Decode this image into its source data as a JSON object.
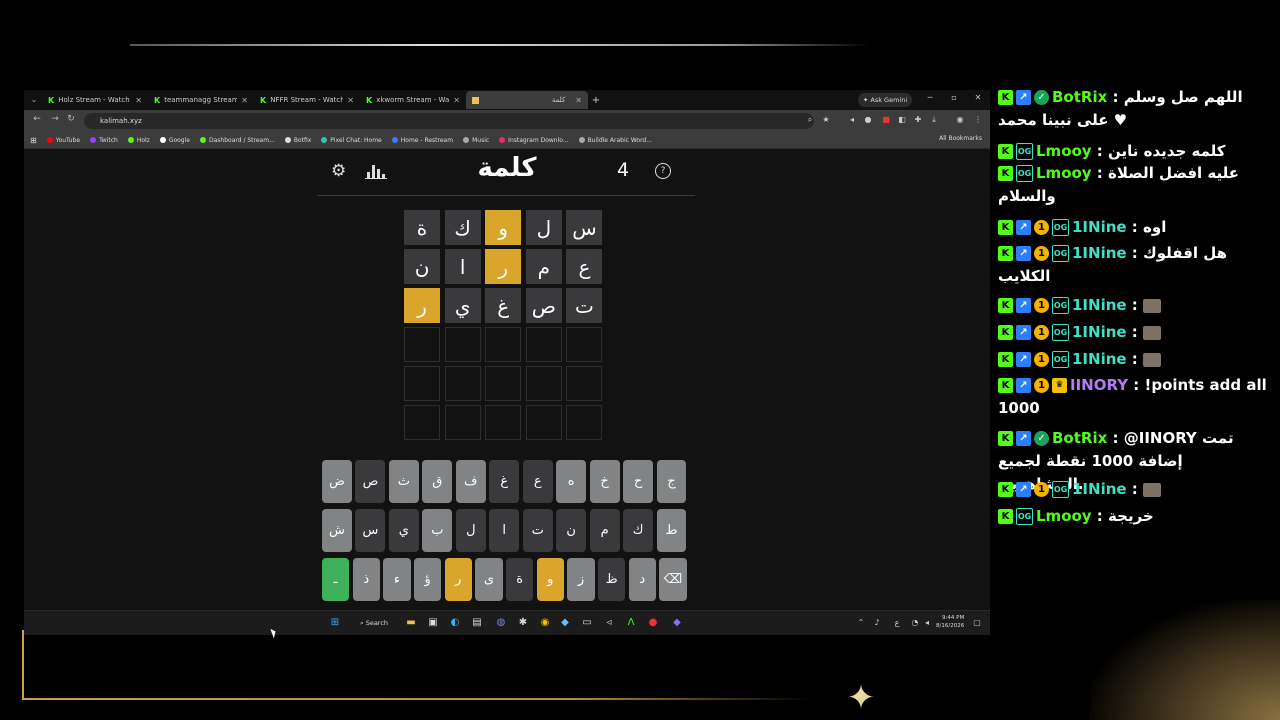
{
  "browser": {
    "tabs": [
      {
        "label": "Holz Stream - Watch Live on Ki",
        "icon": "kick-icon"
      },
      {
        "label": "teammanagg Stream - Kick Da",
        "icon": "kick-icon"
      },
      {
        "label": "NFFR Stream - Watch Live on K",
        "icon": "kick-icon"
      },
      {
        "label": "xkworm Stream - Watch Live on",
        "icon": "kick-icon"
      },
      {
        "label": "كلمة",
        "icon": "kalimah-icon",
        "active": true
      }
    ],
    "ask_gemini": "Ask Gemini",
    "url": "kalimah.xyz",
    "bookmarks": [
      "YouTube",
      "Twitch",
      "Holz",
      "Google",
      "Dashboard / Stream...",
      "Botfix",
      "Pixel Chat: Home",
      "Home - Restream",
      "Music",
      "Instagram Downlo...",
      "Buildle Arabic Word..."
    ],
    "all_bookmarks": "All Bookmarks"
  },
  "game": {
    "title": "كلمة",
    "count": "4",
    "board": [
      [
        {
          "l": "س",
          "s": "absent"
        },
        {
          "l": "ل",
          "s": "absent"
        },
        {
          "l": "و",
          "s": "present"
        },
        {
          "l": "ك",
          "s": "absent"
        },
        {
          "l": "ة",
          "s": "absent"
        }
      ],
      [
        {
          "l": "ع",
          "s": "absent"
        },
        {
          "l": "م",
          "s": "absent"
        },
        {
          "l": "ر",
          "s": "present"
        },
        {
          "l": "ا",
          "s": "absent"
        },
        {
          "l": "ن",
          "s": "absent"
        }
      ],
      [
        {
          "l": "ت",
          "s": "absent"
        },
        {
          "l": "ص",
          "s": "absent"
        },
        {
          "l": "غ",
          "s": "absent"
        },
        {
          "l": "ي",
          "s": "absent"
        },
        {
          "l": "ر",
          "s": "present"
        }
      ],
      [
        {
          "l": "",
          "s": "empty"
        },
        {
          "l": "",
          "s": "empty"
        },
        {
          "l": "",
          "s": "empty"
        },
        {
          "l": "",
          "s": "empty"
        },
        {
          "l": "",
          "s": "empty"
        }
      ],
      [
        {
          "l": "",
          "s": "empty"
        },
        {
          "l": "",
          "s": "empty"
        },
        {
          "l": "",
          "s": "empty"
        },
        {
          "l": "",
          "s": "empty"
        },
        {
          "l": "",
          "s": "empty"
        }
      ],
      [
        {
          "l": "",
          "s": "empty"
        },
        {
          "l": "",
          "s": "empty"
        },
        {
          "l": "",
          "s": "empty"
        },
        {
          "l": "",
          "s": "empty"
        },
        {
          "l": "",
          "s": "empty"
        }
      ]
    ],
    "keyboard": [
      [
        {
          "l": "ج",
          "s": "unused"
        },
        {
          "l": "ح",
          "s": "unused"
        },
        {
          "l": "خ",
          "s": "unused"
        },
        {
          "l": "ه",
          "s": "unused"
        },
        {
          "l": "ع",
          "s": "absent"
        },
        {
          "l": "غ",
          "s": "absent"
        },
        {
          "l": "ف",
          "s": "unused"
        },
        {
          "l": "ق",
          "s": "unused"
        },
        {
          "l": "ث",
          "s": "unused"
        },
        {
          "l": "ص",
          "s": "absent"
        },
        {
          "l": "ض",
          "s": "unused"
        }
      ],
      [
        {
          "l": "ط",
          "s": "unused"
        },
        {
          "l": "ك",
          "s": "absent"
        },
        {
          "l": "م",
          "s": "absent"
        },
        {
          "l": "ن",
          "s": "absent"
        },
        {
          "l": "ت",
          "s": "absent"
        },
        {
          "l": "ا",
          "s": "absent"
        },
        {
          "l": "ل",
          "s": "absent"
        },
        {
          "l": "ب",
          "s": "unused"
        },
        {
          "l": "ي",
          "s": "absent"
        },
        {
          "l": "س",
          "s": "absent"
        },
        {
          "l": "ش",
          "s": "unused"
        }
      ],
      [
        {
          "l": "⌫",
          "s": "unused"
        },
        {
          "l": "د",
          "s": "unused"
        },
        {
          "l": "ظ",
          "s": "absent"
        },
        {
          "l": "ز",
          "s": "unused"
        },
        {
          "l": "و",
          "s": "present"
        },
        {
          "l": "ة",
          "s": "absent"
        },
        {
          "l": "ى",
          "s": "unused"
        },
        {
          "l": "ر",
          "s": "present"
        },
        {
          "l": "ؤ",
          "s": "unused"
        },
        {
          "l": "ء",
          "s": "unused"
        },
        {
          "l": "ذ",
          "s": "unused"
        },
        {
          "l": "ـ",
          "s": "enter"
        }
      ]
    ]
  },
  "taskbar": {
    "search_label": "Search",
    "time": "9:44 PM",
    "date": "8/16/2026",
    "lang": "ع"
  },
  "chat": [
    {
      "badges": [
        "k",
        "arrow",
        "verified"
      ],
      "user": "BotRix",
      "color": "#53fc18",
      "text": "اللهم صل وسلم على نبينا محمد ♥"
    },
    {
      "badges": [
        "k",
        "og"
      ],
      "user": "Lmooy",
      "color": "#53fc18",
      "text": "كلمه جديده ناين"
    },
    {
      "badges": [
        "k",
        "og"
      ],
      "user": "Lmooy",
      "color": "#53fc18",
      "text": "عليه افضل الصلاة والسلام"
    },
    {
      "badges": [
        "k",
        "arrow",
        "coin",
        "og"
      ],
      "user": "1INine",
      "color": "#3fe0c5",
      "text": "اوه"
    },
    {
      "badges": [
        "k",
        "arrow",
        "coin",
        "og"
      ],
      "user": "1INine",
      "color": "#3fe0c5",
      "text": "هل اقفلوك الكلايب"
    },
    {
      "badges": [
        "k",
        "arrow",
        "coin",
        "og"
      ],
      "user": "1INine",
      "color": "#3fe0c5",
      "text": "",
      "emote": true
    },
    {
      "badges": [
        "k",
        "arrow",
        "coin",
        "og"
      ],
      "user": "1INine",
      "color": "#3fe0c5",
      "text": "",
      "emote": true
    },
    {
      "badges": [
        "k",
        "arrow",
        "coin",
        "og"
      ],
      "user": "1INine",
      "color": "#3fe0c5",
      "text": "",
      "emote": true
    },
    {
      "badges": [
        "k",
        "arrow",
        "coin",
        "crown"
      ],
      "user": "IINORY",
      "color": "#b57cf5",
      "text": "!points add all 1000"
    },
    {
      "badges": [
        "k",
        "arrow",
        "verified"
      ],
      "user": "BotRix",
      "color": "#53fc18",
      "text": "@IINORY تمت إضافة 1000 نقطة لجميع المشاهدين."
    },
    {
      "badges": [
        "k",
        "arrow",
        "coin",
        "og"
      ],
      "user": "1INine",
      "color": "#3fe0c5",
      "text": "",
      "emote": true
    },
    {
      "badges": [
        "k",
        "og"
      ],
      "user": "Lmooy",
      "color": "#53fc18",
      "text": "خريجة"
    }
  ]
}
